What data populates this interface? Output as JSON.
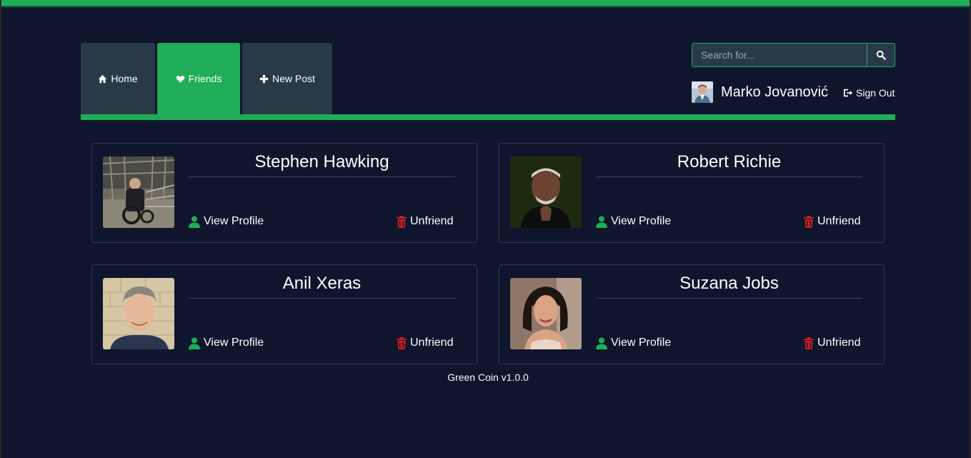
{
  "nav": {
    "tabs": [
      {
        "label": "Home",
        "icon": "home-icon",
        "active": false
      },
      {
        "label": "Friends",
        "icon": "heart-icon",
        "active": true
      },
      {
        "label": "New Post",
        "icon": "plus-icon",
        "active": false
      }
    ]
  },
  "search": {
    "placeholder": "Search for...",
    "value": ""
  },
  "user": {
    "name": "Marko Jovanović",
    "signout_label": "Sign Out"
  },
  "friends": [
    {
      "name": "Stephen Hawking",
      "view_label": "View Profile",
      "unfriend_label": "Unfriend"
    },
    {
      "name": "Robert Richie",
      "view_label": "View Profile",
      "unfriend_label": "Unfriend"
    },
    {
      "name": "Anil Xeras",
      "view_label": "View Profile",
      "unfriend_label": "Unfriend"
    },
    {
      "name": "Suzana Jobs",
      "view_label": "View Profile",
      "unfriend_label": "Unfriend"
    }
  ],
  "footer": {
    "text": "Green Coin v1.0.0"
  },
  "colors": {
    "accent": "#1fad57",
    "background": "#0e152c",
    "tab": "#283a48",
    "danger": "#cc1f1f"
  }
}
